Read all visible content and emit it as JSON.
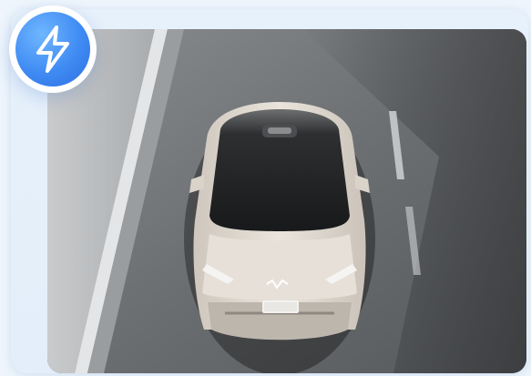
{
  "card": {
    "badge_icon": "lightning-bolt-icon",
    "accent": "#3f8bf3",
    "background": "#eef5fc"
  },
  "photo": {
    "subject": "car-top-view-photo"
  }
}
